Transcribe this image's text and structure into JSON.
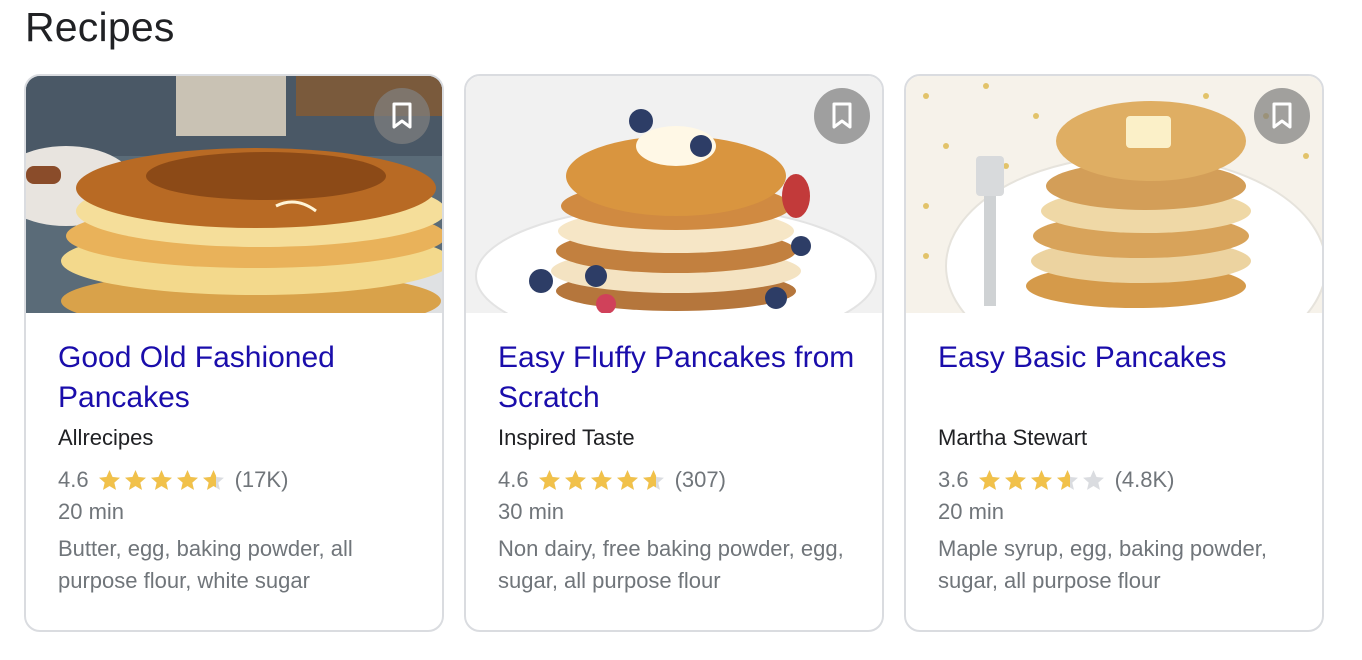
{
  "section_title": "Recipes",
  "colors": {
    "link": "#1a0dab",
    "star": "#f1c14a",
    "star_empty": "#dadce0",
    "muted": "#70757a"
  },
  "cards": [
    {
      "title": "Good Old Fashioned Pancakes",
      "source": "Allrecipes",
      "rating": "4.6",
      "rating_value": 4.6,
      "reviews": "(17K)",
      "time": "20 min",
      "ingredients": "Butter, egg, baking powder, all purpose flour, white sugar",
      "icon": "bookmark-icon"
    },
    {
      "title": "Easy Fluffy Pancakes from Scratch",
      "source": "Inspired Taste",
      "rating": "4.6",
      "rating_value": 4.6,
      "reviews": "(307)",
      "time": "30 min",
      "ingredients": "Non dairy, free baking powder, egg, sugar, all purpose flour",
      "icon": "bookmark-icon"
    },
    {
      "title": "Easy Basic Pancakes",
      "source": "Martha Stewart",
      "rating": "3.6",
      "rating_value": 3.6,
      "reviews": "(4.8K)",
      "time": "20 min",
      "ingredients": "Maple syrup, egg, baking powder, sugar, all purpose flour",
      "icon": "bookmark-icon"
    }
  ]
}
